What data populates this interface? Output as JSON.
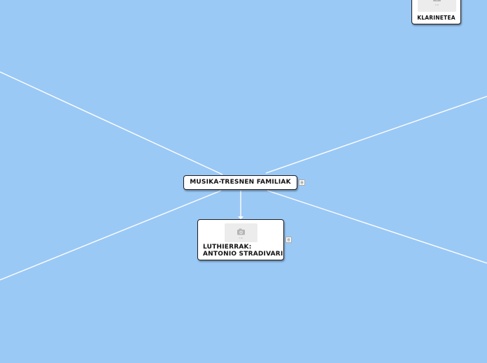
{
  "map": {
    "central_topic": "MUSIKA-TRESNEN FAMILIAK",
    "children": [
      {
        "label": "LUTHIERRAK:\nANTONIO STRADIVARI",
        "has_image": true,
        "has_note": true
      },
      {
        "label": "KLARINETEA",
        "has_image": true,
        "has_note": false
      }
    ],
    "central_has_note": true
  },
  "colors": {
    "background": "#9bc9f6",
    "connector": "#ffffff",
    "node_fill": "#ffffff",
    "node_border": "#1e1e1e",
    "image_placeholder": "#ececec"
  },
  "icons": {
    "image_placeholder": "camera-icon",
    "note": "note-icon"
  }
}
